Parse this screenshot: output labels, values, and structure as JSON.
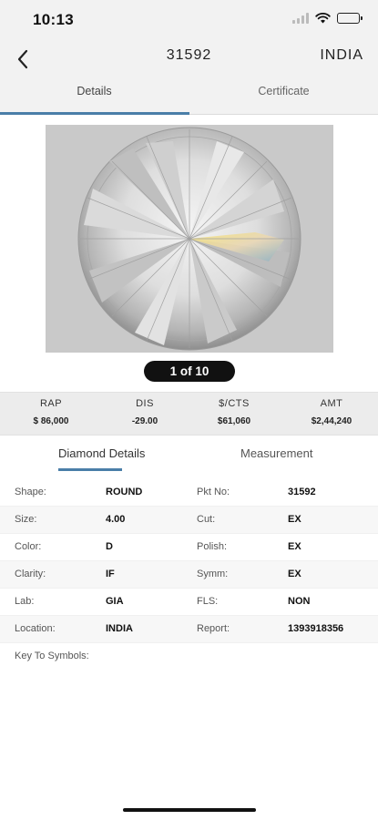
{
  "status_bar": {
    "time": "10:13"
  },
  "nav": {
    "title": "31592",
    "right_label": "INDIA"
  },
  "tabs": [
    {
      "label": "Details",
      "active": true
    },
    {
      "label": "Certificate",
      "active": false
    }
  ],
  "gallery": {
    "pager_text": "1 of 10"
  },
  "prices": [
    {
      "label": "RAP",
      "value": "$ 86,000"
    },
    {
      "label": "DIS",
      "value": "-29.00"
    },
    {
      "label": "$/CTS",
      "value": "$61,060"
    },
    {
      "label": "AMT",
      "value": "$2,44,240"
    }
  ],
  "detail_tabs": [
    {
      "label": "Diamond Details",
      "active": true
    },
    {
      "label": "Measurement",
      "active": false
    }
  ],
  "details": {
    "rows": [
      {
        "l1": "Shape:",
        "v1": "ROUND",
        "l2": "Pkt No:",
        "v2": "31592"
      },
      {
        "l1": "Size:",
        "v1": "4.00",
        "l2": "Cut:",
        "v2": "EX"
      },
      {
        "l1": "Color:",
        "v1": "D",
        "l2": "Polish:",
        "v2": "EX"
      },
      {
        "l1": "Clarity:",
        "v1": "IF",
        "l2": "Symm:",
        "v2": "EX"
      },
      {
        "l1": "Lab:",
        "v1": "GIA",
        "l2": "FLS:",
        "v2": "NON"
      },
      {
        "l1": "Location:",
        "v1": "INDIA",
        "l2": "Report:",
        "v2": "1393918356"
      }
    ],
    "key_to_symbols_label": "Key To Symbols:"
  },
  "colors": {
    "accent": "#4a7ea8",
    "header_bg": "#f2f2f2",
    "price_bar_bg": "#ececec"
  },
  "icons": {
    "back": "chevron-left-icon",
    "signal": "signal-icon",
    "wifi": "wifi-icon",
    "battery": "battery-icon"
  }
}
